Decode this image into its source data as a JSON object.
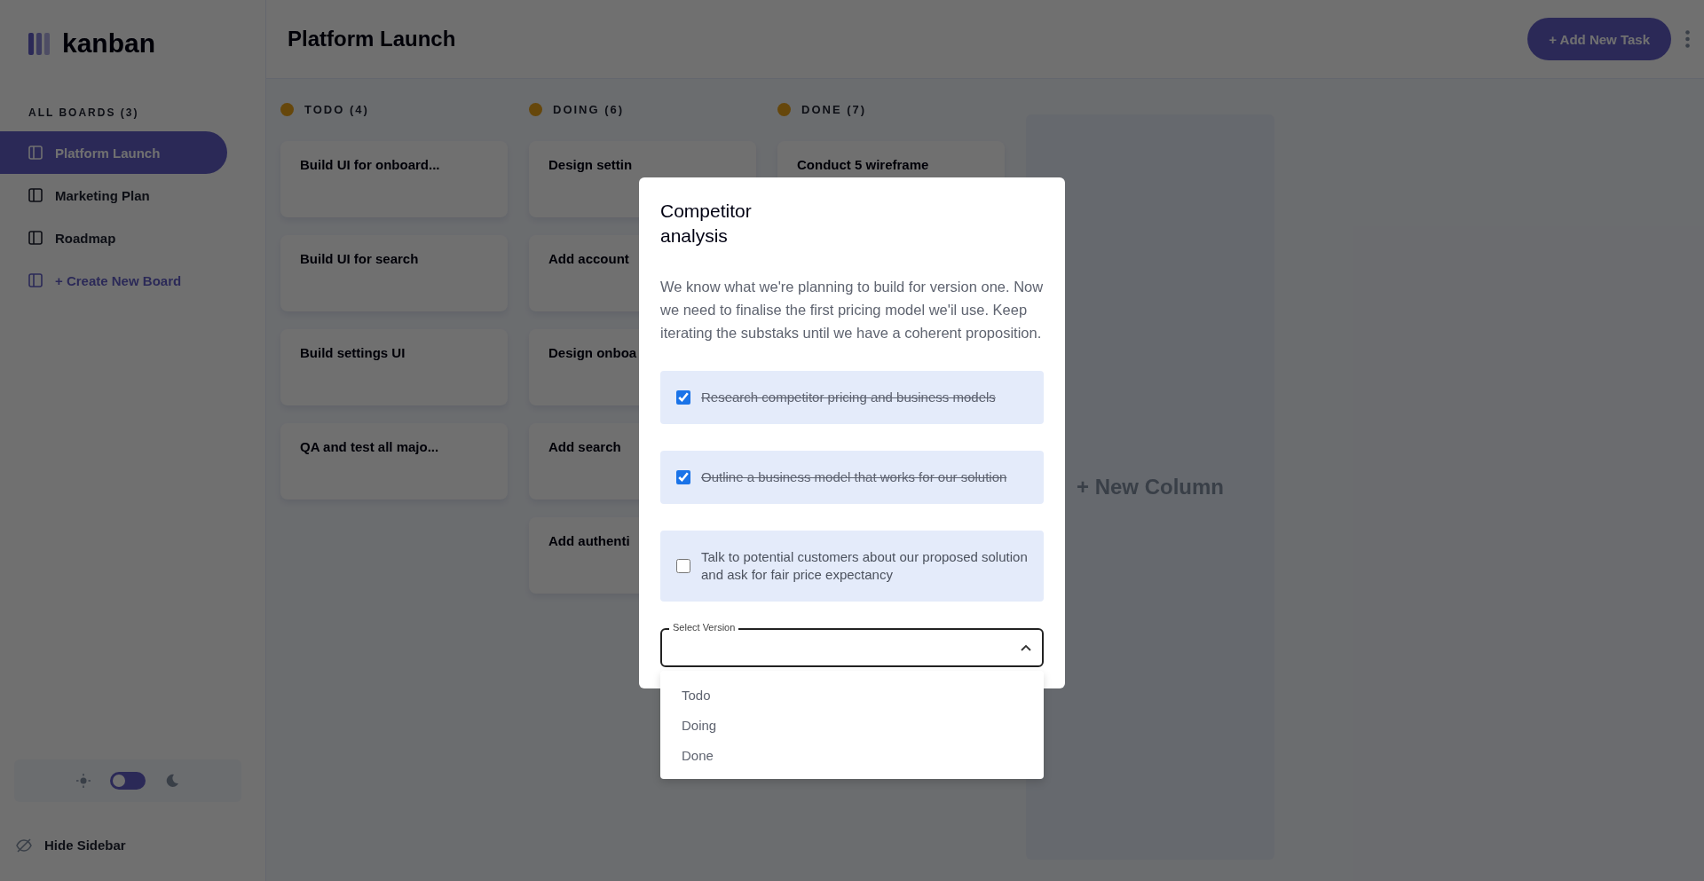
{
  "sidebar": {
    "logo": "kanban",
    "section_title": "ALL BOARDS (3)",
    "boards": [
      {
        "label": "Platform Launch",
        "selected": true
      },
      {
        "label": "Marketing Plan",
        "selected": false
      },
      {
        "label": "Roadmap",
        "selected": false
      }
    ],
    "create_board": "+ Create New Board",
    "dark_mode": false,
    "hide_sidebar": "Hide Sidebar"
  },
  "header": {
    "board_title": "Platform Launch",
    "add_task_button": "+ Add New Task"
  },
  "columns": [
    {
      "title": "TODO (4)",
      "cards": [
        {
          "title": "Build UI for onboard..."
        },
        {
          "title": "Build UI for search"
        },
        {
          "title": "Build settings UI"
        },
        {
          "title": "QA and test all majo..."
        }
      ]
    },
    {
      "title": "DOING (6)",
      "cards": [
        {
          "title": "Design settin"
        },
        {
          "title": "Add account"
        },
        {
          "title": "Design onboa"
        },
        {
          "title": "Add search"
        },
        {
          "title": "Add authenti"
        }
      ]
    },
    {
      "title": "DONE (7)",
      "cards": [
        {
          "title": "Conduct 5 wireframe"
        }
      ]
    }
  ],
  "new_column": "+ New Column",
  "modal": {
    "title": "Competitor analysis",
    "description": "We know what we're planning to build for version one. Now we need to finalise the first pricing model we'il use. Keep iterating the substaks until we have a coherent proposition.",
    "subtasks": [
      {
        "label": "Research competitor pricing and business models",
        "checked": true
      },
      {
        "label": "Outline a business model that works for our solution",
        "checked": true
      },
      {
        "label": "Talk to potential customers about our proposed solution and ask for fair price expectancy",
        "checked": false
      }
    ],
    "select": {
      "label": "Select Version",
      "expanded": true,
      "options": [
        {
          "label": "Todo",
          "selected": false
        },
        {
          "label": "Doing",
          "selected": false
        },
        {
          "label": "Done",
          "selected": false
        }
      ]
    }
  }
}
